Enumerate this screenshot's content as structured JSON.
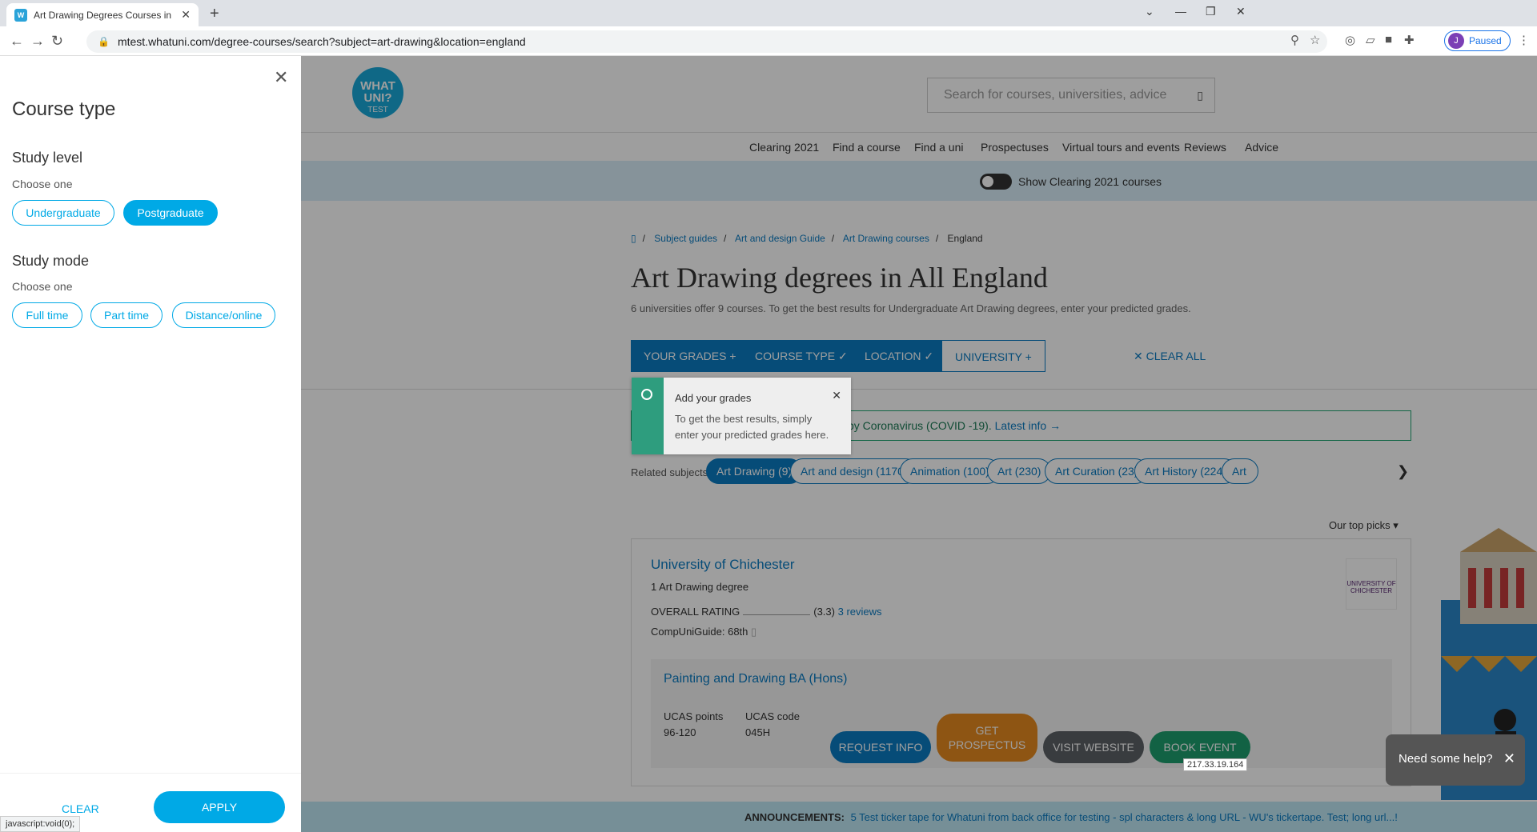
{
  "browser": {
    "tab_title": "Art Drawing Degrees Courses in",
    "url": "mtest.whatuni.com/degree-courses/search?subject=art-drawing&location=england",
    "profile_initial": "J",
    "profile_status": "Paused",
    "status_text": "javascript:void(0);"
  },
  "header": {
    "logo_line1": "WHAT",
    "logo_line2": "UNI?",
    "logo_line3": "TEST",
    "search_placeholder": "Search for courses, universities, advice",
    "nav": [
      "Clearing 2021",
      "Find a course",
      "Find a uni",
      "Prospectuses",
      "Virtual tours and events",
      "Reviews",
      "Advice"
    ],
    "clearing_toggle_label": "Show Clearing 2021 courses"
  },
  "breadcrumb": [
    "Subject guides",
    "Art and design Guide",
    "Art Drawing courses",
    "England"
  ],
  "page": {
    "title": "Art Drawing degrees in All England",
    "subtitle": "6 universities offer 9 courses. To get the best results for Undergraduate Art Drawing degrees, enter your predicted grades."
  },
  "filters": {
    "your_grades": "YOUR GRADES",
    "course_type": "COURSE TYPE",
    "location": "LOCATION",
    "university": "UNIVERSITY",
    "clear_all": "CLEAR ALL"
  },
  "grades_popup": {
    "title": "Add your grades",
    "text": "To get the best results, simply enter your predicted grades here."
  },
  "covid": {
    "text": "by Coronavirus (COVID -19).",
    "link": "Latest info"
  },
  "related": {
    "label": "Related subjects:",
    "chips": [
      "Art Drawing (9)",
      "Art and design (1170)",
      "Animation (100)",
      "Art (230)",
      "Art Curation (23)",
      "Art History (224)",
      "Art"
    ]
  },
  "sort_label": "Our top picks",
  "result": {
    "uni_name": "University of Chichester",
    "uni_sub": "1 Art Drawing degree",
    "rating_label": "OVERALL RATING",
    "rating_value": "(3.3)",
    "reviews": "3 reviews",
    "cug": "CompUniGuide: 68th",
    "logo_text": "UNIVERSITY OF CHICHESTER",
    "course_title": "Painting and Drawing BA (Hons)",
    "ucas_points_label": "UCAS points",
    "ucas_points": "96-120",
    "ucas_code_label": "UCAS code",
    "ucas_code": "045H",
    "btn_request": "REQUEST INFO",
    "btn_get_1": "GET",
    "btn_get_2": "PROSPECTUS",
    "btn_visit": "VISIT WEBSITE",
    "btn_book": "BOOK EVENT"
  },
  "help": "Need some help?",
  "ticker": {
    "label": "ANNOUNCEMENTS:",
    "text": "5 Test ticker tape for Whatuni from back office for testing - spl characters & long URL - WU's tickertape. Test; long url...!"
  },
  "ip": "217.33.19.164",
  "panel": {
    "heading": "Course type",
    "study_level": "Study level",
    "choose_one": "Choose one",
    "undergraduate": "Undergraduate",
    "postgraduate": "Postgraduate",
    "study_mode": "Study mode",
    "full_time": "Full time",
    "part_time": "Part time",
    "distance": "Distance/online",
    "clear": "CLEAR",
    "apply": "APPLY"
  },
  "colors": {
    "accent": "#00a9e6",
    "brand_blue": "#0b7bc2",
    "prospectus": "#e58a1f",
    "visit": "#5c6166",
    "book": "#1e9e6e"
  }
}
